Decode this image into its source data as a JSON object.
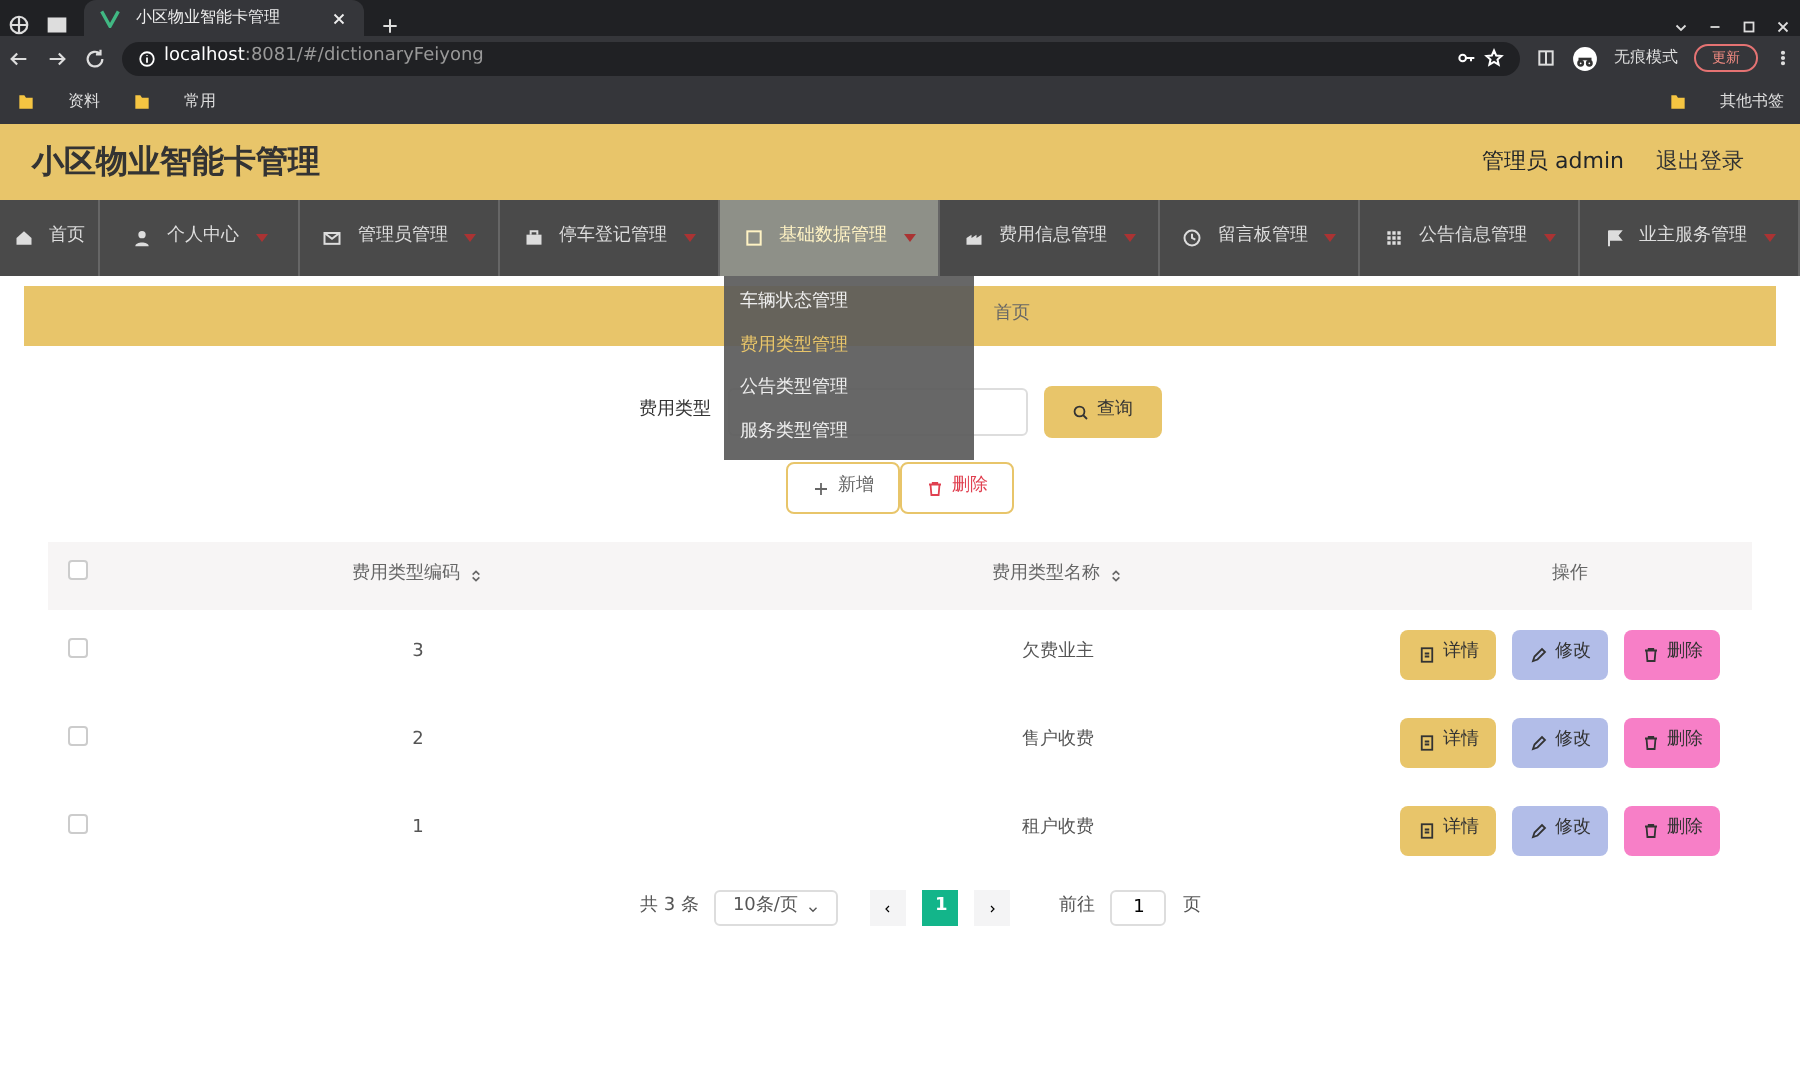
{
  "browser": {
    "tab_title": "小区物业智能卡管理",
    "url_host": "localhost",
    "url_rest": ":8081/#/dictionaryFeiyong",
    "profile": "无痕模式",
    "update": "更新",
    "bookmarks": [
      "资料",
      "常用"
    ],
    "other_bookmarks": "其他书签"
  },
  "header": {
    "title": "小区物业智能卡管理",
    "user": "管理员 admin",
    "logout": "退出登录"
  },
  "nav": [
    {
      "label": "首页",
      "selected": false,
      "caret": false
    },
    {
      "label": "个人中心",
      "selected": false,
      "caret": true
    },
    {
      "label": "管理员管理",
      "selected": false,
      "caret": true
    },
    {
      "label": "停车登记管理",
      "selected": false,
      "caret": true
    },
    {
      "label": "基础数据管理",
      "selected": true,
      "caret": true
    },
    {
      "label": "费用信息管理",
      "selected": false,
      "caret": true
    },
    {
      "label": "留言板管理",
      "selected": false,
      "caret": true
    },
    {
      "label": "公告信息管理",
      "selected": false,
      "caret": true
    },
    {
      "label": "业主服务管理",
      "selected": false,
      "caret": true
    }
  ],
  "dropdown": [
    {
      "label": "车辆状态管理",
      "selected": false
    },
    {
      "label": "费用类型管理",
      "selected": true
    },
    {
      "label": "公告类型管理",
      "selected": false
    },
    {
      "label": "服务类型管理",
      "selected": false
    }
  ],
  "breadcrumb": "首页",
  "search": {
    "label": "费用类型",
    "button": "查询"
  },
  "actions": [
    "新增",
    "删除"
  ],
  "table": {
    "all_checked": false,
    "columns": [
      "费用类型编码",
      "费用类型名称",
      "操作"
    ],
    "rows": [
      {
        "checked": false,
        "code": "3",
        "name": "欠费业主",
        "actions": [
          "详情",
          "修改",
          "删除"
        ]
      },
      {
        "checked": false,
        "code": "2",
        "name": "售户收费",
        "actions": [
          "详情",
          "修改",
          "删除"
        ]
      },
      {
        "checked": false,
        "code": "1",
        "name": "租户收费",
        "actions": [
          "详情",
          "修改",
          "删除"
        ]
      }
    ]
  },
  "pagination": {
    "total": "共 3 条",
    "page_size": "10条/页",
    "pages": [
      {
        "label": "1",
        "selected": true
      }
    ],
    "goto": "前往",
    "goto_value": "1",
    "suffix": "页"
  }
}
